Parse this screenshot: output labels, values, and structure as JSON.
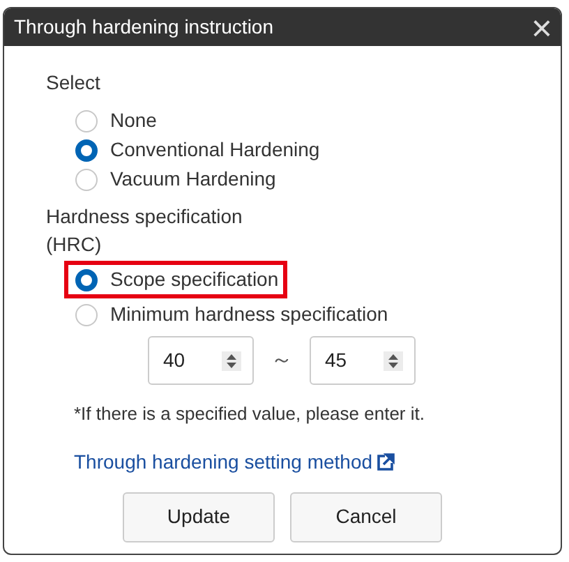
{
  "window": {
    "title": "Through hardening instruction",
    "close": "×"
  },
  "select": {
    "label": "Select",
    "options": [
      {
        "label": "None",
        "selected": false
      },
      {
        "label": "Conventional Hardening",
        "selected": true
      },
      {
        "label": "Vacuum Hardening",
        "selected": false
      }
    ]
  },
  "hardness": {
    "label": "Hardness specification",
    "unit": "(HRC)",
    "options": [
      {
        "label": "Scope specification",
        "selected": true,
        "highlighted": true
      },
      {
        "label": "Minimum hardness specification",
        "selected": false,
        "highlighted": false
      }
    ],
    "min_value": "40",
    "separator": "～",
    "max_value": "45"
  },
  "note": "*If there is a specified value, please enter it.",
  "link": "Through hardening setting method",
  "buttons": [
    "Update",
    "Cancel"
  ]
}
